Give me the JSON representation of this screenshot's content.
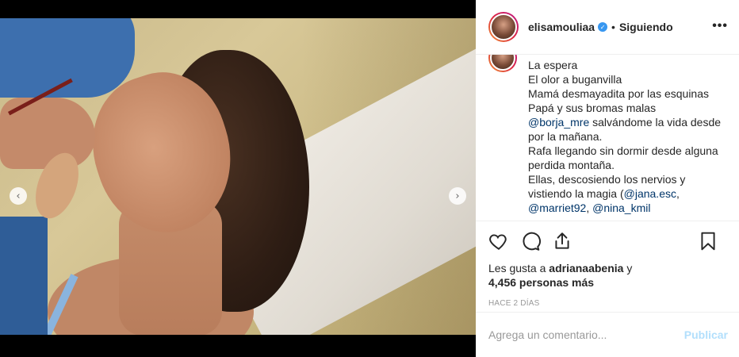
{
  "post": {
    "username": "elisamouliaa",
    "follow_status": "Siguiendo",
    "separator": "•",
    "verified_glyph": "✓",
    "more_glyph": "•••",
    "carousel": {
      "prev_glyph": "‹",
      "next_glyph": "›",
      "dot_count": 10,
      "active_dot": 5
    }
  },
  "caption": {
    "lines": [
      {
        "text": "La espera"
      },
      {
        "text": "El olor a buganvilla"
      },
      {
        "text": "Mamá desmayadita por las esquinas"
      },
      {
        "text": "Papá y sus bromas malas"
      },
      {
        "mention": "@borja_mre",
        "text": " salvándome la vida desde"
      },
      {
        "text": "por la mañana."
      },
      {
        "text": "Rafa llegando sin dormir desde alguna"
      },
      {
        "text": "perdida montaña."
      },
      {
        "text": "Ellas, descosiendo los nervios y"
      },
      {
        "pre": "vistiendo la magia (",
        "mention": "@jana.esc",
        "text": ","
      },
      {
        "mention": "@marriet92",
        "text": ", ",
        "mention2": "@nina_kmil"
      }
    ]
  },
  "likes": {
    "prefix": "Les gusta a ",
    "user": "adrianaabenia",
    "suffix": " y",
    "count": "4,456 personas más"
  },
  "timestamp": "HACE 2 DÍAS",
  "comment": {
    "placeholder": "Agrega un comentario...",
    "publish": "Publicar"
  },
  "icons": {
    "like": "heart-icon",
    "comment": "comment-icon",
    "share": "share-icon",
    "save": "bookmark-icon"
  },
  "colors": {
    "link": "#003569",
    "verified": "#3897f0",
    "publish": "#b2dffc"
  }
}
